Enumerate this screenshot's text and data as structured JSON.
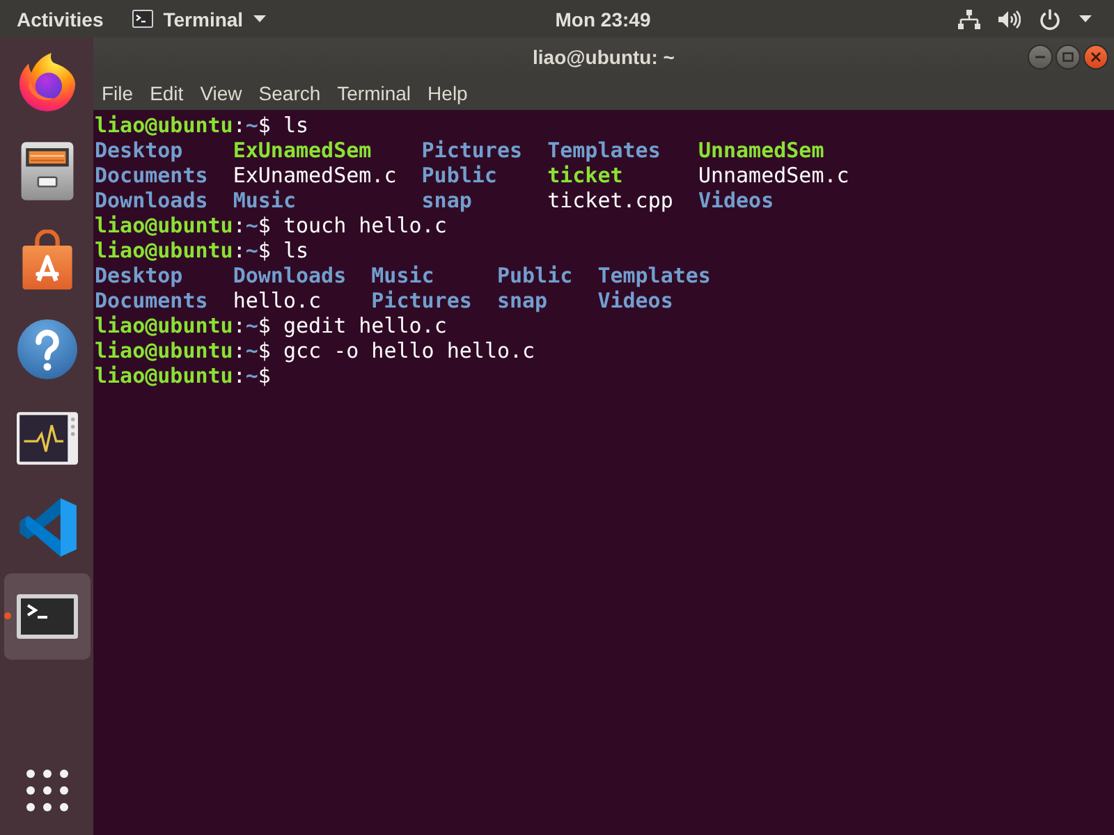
{
  "top_bar": {
    "activities": "Activities",
    "app_menu": "Terminal",
    "clock": "Mon 23:49"
  },
  "dock": {
    "items": [
      {
        "kind": "browser",
        "selected": false,
        "running": false
      },
      {
        "kind": "files",
        "selected": false,
        "running": false
      },
      {
        "kind": "store",
        "selected": false,
        "running": false
      },
      {
        "kind": "help",
        "selected": false,
        "running": false
      },
      {
        "kind": "monitor",
        "selected": false,
        "running": false
      },
      {
        "kind": "editor",
        "selected": false,
        "running": false
      },
      {
        "kind": "terminal",
        "selected": true,
        "running": true
      },
      {
        "kind": "apps",
        "selected": false,
        "running": false
      }
    ]
  },
  "window": {
    "title": "liao@ubuntu: ~",
    "menu": [
      "File",
      "Edit",
      "View",
      "Search",
      "Terminal",
      "Help"
    ]
  },
  "terminal": {
    "lines": [
      {
        "kind": "prompt",
        "user": "liao@ubuntu",
        "separator": ":",
        "path": "~",
        "symbol": "$",
        "command": "ls"
      },
      {
        "kind": "listing",
        "rows": [
          [
            {
              "name": "Desktop",
              "kind": "directory"
            },
            {
              "name": "ExUnamedSem",
              "kind": "executable"
            },
            {
              "name": "Pictures",
              "kind": "directory"
            },
            {
              "name": "Templates",
              "kind": "directory"
            },
            {
              "name": "UnnamedSem",
              "kind": "executable"
            }
          ],
          [
            {
              "name": "Documents",
              "kind": "directory"
            },
            {
              "name": "ExUnamedSem.c",
              "kind": "file"
            },
            {
              "name": "Public",
              "kind": "directory"
            },
            {
              "name": "ticket",
              "kind": "executable"
            },
            {
              "name": "UnnamedSem.c",
              "kind": "file"
            }
          ],
          [
            {
              "name": "Downloads",
              "kind": "directory"
            },
            {
              "name": "Music",
              "kind": "directory"
            },
            {
              "name": "snap",
              "kind": "directory"
            },
            {
              "name": "ticket.cpp",
              "kind": "file"
            },
            {
              "name": "Videos",
              "kind": "directory"
            }
          ]
        ]
      },
      {
        "kind": "prompt",
        "user": "liao@ubuntu",
        "separator": ":",
        "path": "~",
        "symbol": "$",
        "command": "touch hello.c"
      },
      {
        "kind": "prompt",
        "user": "liao@ubuntu",
        "separator": ":",
        "path": "~",
        "symbol": "$",
        "command": "ls"
      },
      {
        "kind": "listing",
        "rows": [
          [
            {
              "name": "Desktop",
              "kind": "directory"
            },
            {
              "name": "Downloads",
              "kind": "directory"
            },
            {
              "name": "Music",
              "kind": "directory"
            },
            {
              "name": "Public",
              "kind": "directory"
            },
            {
              "name": "Templates",
              "kind": "directory"
            }
          ],
          [
            {
              "name": "Documents",
              "kind": "directory"
            },
            {
              "name": "hello.c",
              "kind": "file"
            },
            {
              "name": "Pictures",
              "kind": "directory"
            },
            {
              "name": "snap",
              "kind": "directory"
            },
            {
              "name": "Videos",
              "kind": "directory"
            }
          ]
        ]
      },
      {
        "kind": "prompt",
        "user": "liao@ubuntu",
        "separator": ":",
        "path": "~",
        "symbol": "$",
        "command": "gedit hello.c"
      },
      {
        "kind": "prompt",
        "user": "liao@ubuntu",
        "separator": ":",
        "path": "~",
        "symbol": "$",
        "command": "gcc -o hello hello.c"
      },
      {
        "kind": "prompt",
        "user": "liao@ubuntu",
        "separator": ":",
        "path": "~",
        "symbol": "$"
      }
    ]
  }
}
